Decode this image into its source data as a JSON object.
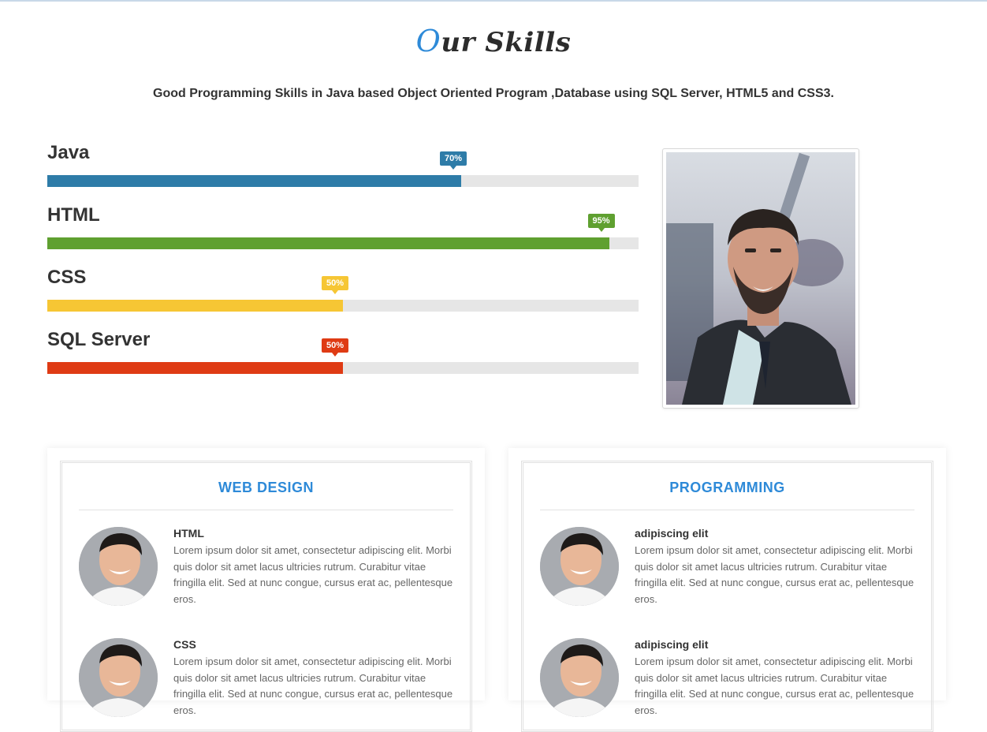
{
  "header": {
    "title_first_letter": "O",
    "title_rest": "ur Skills",
    "subtitle": "Good Programming Skills in Java based Object Oriented Program ,Database using SQL Server, HTML5 and CSS3."
  },
  "skills": [
    {
      "name": "Java",
      "percent": 70,
      "label": "70%",
      "color": "#2e7ca8"
    },
    {
      "name": "HTML",
      "percent": 95,
      "label": "95%",
      "color": "#5fa030"
    },
    {
      "name": "CSS",
      "percent": 50,
      "label": "50%",
      "color": "#f6c634"
    },
    {
      "name": "SQL Server",
      "percent": 50,
      "label": "50%",
      "color": "#df3b14"
    }
  ],
  "cards": [
    {
      "title": "WEB DESIGN",
      "items": [
        {
          "title": "HTML",
          "text": "Lorem ipsum dolor sit amet, consectetur adipiscing elit. Morbi quis dolor sit amet lacus ultricies rutrum. Curabitur vitae fringilla elit. Sed at nunc congue, cursus erat ac, pellentesque eros."
        },
        {
          "title": "CSS",
          "text": "Lorem ipsum dolor sit amet, consectetur adipiscing elit. Morbi quis dolor sit amet lacus ultricies rutrum. Curabitur vitae fringilla elit. Sed at nunc congue, cursus erat ac, pellentesque eros."
        }
      ]
    },
    {
      "title": "PROGRAMMING",
      "items": [
        {
          "title": "adipiscing elit",
          "text": "Lorem ipsum dolor sit amet, consectetur adipiscing elit. Morbi quis dolor sit amet lacus ultricies rutrum. Curabitur vitae fringilla elit. Sed at nunc congue, cursus erat ac, pellentesque eros."
        },
        {
          "title": "adipiscing elit",
          "text": "Lorem ipsum dolor sit amet, consectetur adipiscing elit. Morbi quis dolor sit amet lacus ultricies rutrum. Curabitur vitae fringilla elit. Sed at nunc congue, cursus erat ac, pellentesque eros."
        }
      ]
    }
  ],
  "colors": {
    "accent": "#2e8ad8",
    "track": "#e6e6e6"
  }
}
